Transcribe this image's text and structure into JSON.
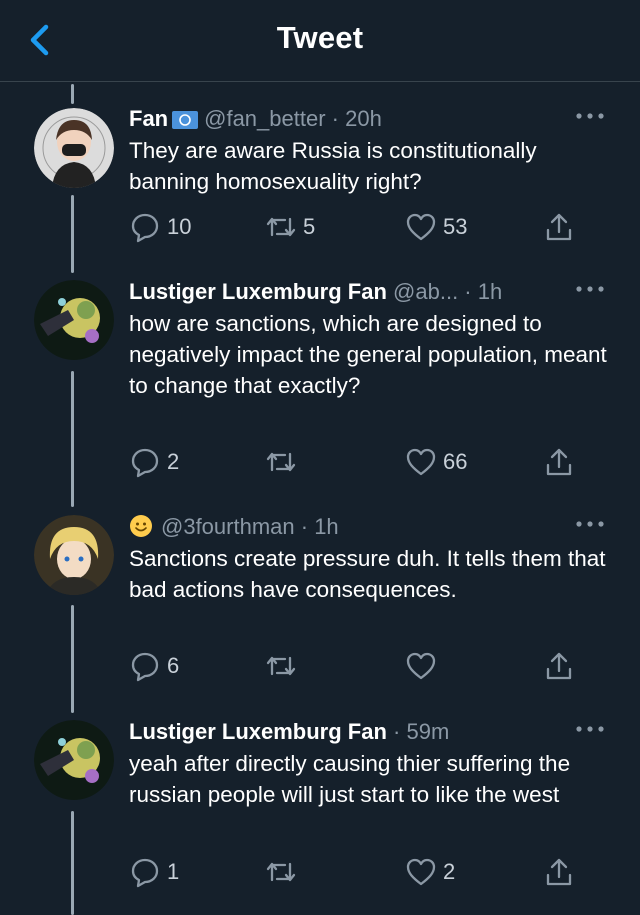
{
  "header": {
    "title": "Tweet"
  },
  "tweets": [
    {
      "name": "Fan",
      "handle": "@fan_better",
      "time": "20h",
      "text": "They are aware Russia is constitutionally banning homosexuality right?",
      "replies": "10",
      "retweets": "5",
      "likes": "53"
    },
    {
      "name": "Lustiger Luxemburg Fan",
      "handle": "@ab...",
      "time": "1h",
      "text": "how are sanctions, which are designed to negatively impact the general population, meant to change that exactly?",
      "replies": "2",
      "retweets": "",
      "likes": "66"
    },
    {
      "name": "",
      "handle": "@3fourthman",
      "time": "1h",
      "text": "Sanctions create pressure duh. It tells them that bad actions have consequences.",
      "replies": "6",
      "retweets": "",
      "likes": ""
    },
    {
      "name": "Lustiger Luxemburg Fan",
      "handle": "",
      "time": "59m",
      "text": "yeah after directly causing thier suffering the russian people will just start to like the west",
      "replies": "1",
      "retweets": "",
      "likes": "2"
    }
  ],
  "colors": {
    "background": "#15202b",
    "accent": "#1d9bf0",
    "muted": "#8b98a5"
  }
}
